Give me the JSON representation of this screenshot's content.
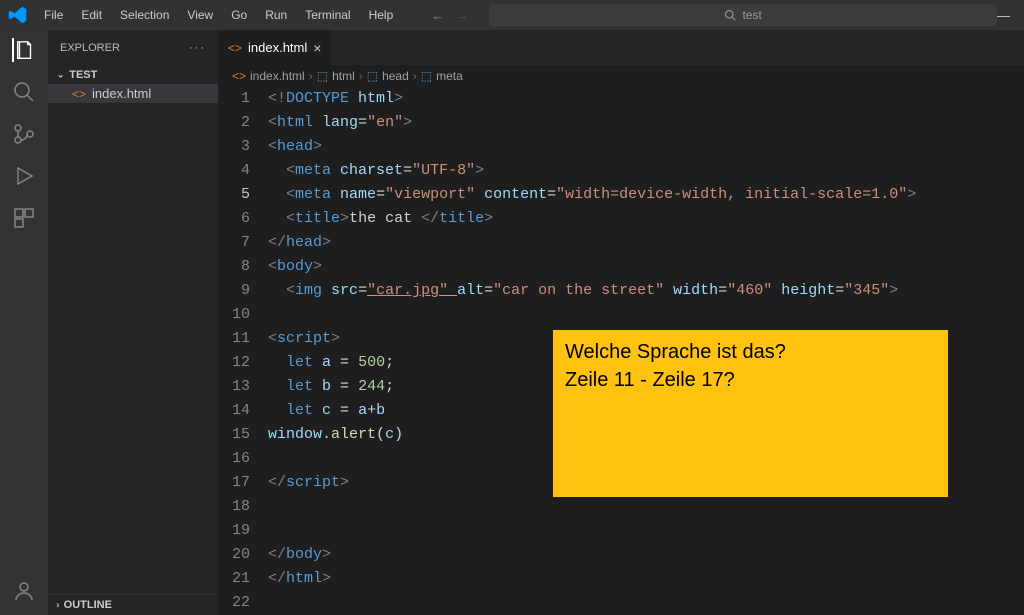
{
  "menu": [
    "File",
    "Edit",
    "Selection",
    "View",
    "Go",
    "Run",
    "Terminal",
    "Help"
  ],
  "search": {
    "placeholder": "test"
  },
  "sidebar": {
    "title": "EXPLORER",
    "folder": "TEST",
    "file": "index.html",
    "outline": "OUTLINE"
  },
  "tab": {
    "name": "index.html"
  },
  "breadcrumb": [
    "index.html",
    "html",
    "head",
    "meta"
  ],
  "annotation": {
    "line1": "Welche Sprache ist das?",
    "line2": "Zeile 11 - Zeile 17?"
  },
  "code": {
    "current_line": 5,
    "lines": [
      {
        "n": 1,
        "tokens": [
          {
            "c": "t-gray",
            "t": "<!"
          },
          {
            "c": "t-blue",
            "t": "DOCTYPE "
          },
          {
            "c": "t-attr",
            "t": "html"
          },
          {
            "c": "t-gray",
            "t": ">"
          }
        ]
      },
      {
        "n": 2,
        "tokens": [
          {
            "c": "t-gray",
            "t": "<"
          },
          {
            "c": "t-blue",
            "t": "html "
          },
          {
            "c": "t-attr",
            "t": "lang"
          },
          {
            "c": "t-txt",
            "t": "="
          },
          {
            "c": "t-str",
            "t": "\"en\""
          },
          {
            "c": "t-gray",
            "t": ">"
          }
        ]
      },
      {
        "n": 3,
        "tokens": [
          {
            "c": "t-gray",
            "t": "<"
          },
          {
            "c": "t-blue",
            "t": "head"
          },
          {
            "c": "t-gray",
            "t": ">"
          }
        ]
      },
      {
        "n": 4,
        "tokens": [
          {
            "c": "",
            "t": "  "
          },
          {
            "c": "t-gray",
            "t": "<"
          },
          {
            "c": "t-blue",
            "t": "meta "
          },
          {
            "c": "t-attr",
            "t": "charset"
          },
          {
            "c": "t-txt",
            "t": "="
          },
          {
            "c": "t-str",
            "t": "\"UTF-8\""
          },
          {
            "c": "t-gray",
            "t": ">"
          }
        ]
      },
      {
        "n": 5,
        "tokens": [
          {
            "c": "",
            "t": "  "
          },
          {
            "c": "t-gray",
            "t": "<"
          },
          {
            "c": "t-blue",
            "t": "meta "
          },
          {
            "c": "t-attr",
            "t": "name"
          },
          {
            "c": "t-txt",
            "t": "="
          },
          {
            "c": "t-str",
            "t": "\"viewport\" "
          },
          {
            "c": "t-attr",
            "t": "content"
          },
          {
            "c": "t-txt",
            "t": "="
          },
          {
            "c": "t-str",
            "t": "\"width=device-width, initial-scale=1.0\""
          },
          {
            "c": "t-gray",
            "t": ">"
          }
        ]
      },
      {
        "n": 6,
        "tokens": [
          {
            "c": "",
            "t": "  "
          },
          {
            "c": "t-gray",
            "t": "<"
          },
          {
            "c": "t-blue",
            "t": "title"
          },
          {
            "c": "t-gray",
            "t": ">"
          },
          {
            "c": "t-txt",
            "t": "the cat "
          },
          {
            "c": "t-gray",
            "t": "</"
          },
          {
            "c": "t-blue",
            "t": "title"
          },
          {
            "c": "t-gray",
            "t": ">"
          }
        ]
      },
      {
        "n": 7,
        "tokens": [
          {
            "c": "t-gray",
            "t": "</"
          },
          {
            "c": "t-blue",
            "t": "head"
          },
          {
            "c": "t-gray",
            "t": ">"
          }
        ]
      },
      {
        "n": 8,
        "tokens": [
          {
            "c": "t-gray",
            "t": "<"
          },
          {
            "c": "t-blue",
            "t": "body"
          },
          {
            "c": "t-gray",
            "t": ">"
          }
        ]
      },
      {
        "n": 9,
        "tokens": [
          {
            "c": "",
            "t": "  "
          },
          {
            "c": "t-gray",
            "t": "<"
          },
          {
            "c": "t-blue",
            "t": "img "
          },
          {
            "c": "t-attr",
            "t": "src"
          },
          {
            "c": "t-txt",
            "t": "="
          },
          {
            "c": "t-str t-ul",
            "t": "\"car.jpg\" "
          },
          {
            "c": "t-attr",
            "t": "alt"
          },
          {
            "c": "t-txt",
            "t": "="
          },
          {
            "c": "t-str",
            "t": "\"car on the street\" "
          },
          {
            "c": "t-attr",
            "t": "width"
          },
          {
            "c": "t-txt",
            "t": "="
          },
          {
            "c": "t-str",
            "t": "\"460\" "
          },
          {
            "c": "t-attr",
            "t": "height"
          },
          {
            "c": "t-txt",
            "t": "="
          },
          {
            "c": "t-str",
            "t": "\"345\""
          },
          {
            "c": "t-gray",
            "t": ">"
          }
        ]
      },
      {
        "n": 10,
        "tokens": []
      },
      {
        "n": 11,
        "tokens": [
          {
            "c": "t-gray",
            "t": "<"
          },
          {
            "c": "t-blue",
            "t": "script"
          },
          {
            "c": "t-gray",
            "t": ">"
          }
        ]
      },
      {
        "n": 12,
        "tokens": [
          {
            "c": "",
            "t": "  "
          },
          {
            "c": "t-kw",
            "t": "let "
          },
          {
            "c": "t-var",
            "t": "a "
          },
          {
            "c": "t-txt",
            "t": "= "
          },
          {
            "c": "t-num",
            "t": "500"
          },
          {
            "c": "t-txt",
            "t": ";"
          }
        ]
      },
      {
        "n": 13,
        "tokens": [
          {
            "c": "",
            "t": "  "
          },
          {
            "c": "t-kw",
            "t": "let "
          },
          {
            "c": "t-var",
            "t": "b "
          },
          {
            "c": "t-txt",
            "t": "= "
          },
          {
            "c": "t-num",
            "t": "244"
          },
          {
            "c": "t-txt",
            "t": ";"
          }
        ]
      },
      {
        "n": 14,
        "tokens": [
          {
            "c": "",
            "t": "  "
          },
          {
            "c": "t-kw",
            "t": "let "
          },
          {
            "c": "t-var",
            "t": "c "
          },
          {
            "c": "t-txt",
            "t": "= "
          },
          {
            "c": "t-var",
            "t": "a"
          },
          {
            "c": "t-txt",
            "t": "+"
          },
          {
            "c": "t-var",
            "t": "b"
          }
        ]
      },
      {
        "n": 15,
        "tokens": [
          {
            "c": "t-var",
            "t": "window"
          },
          {
            "c": "t-txt",
            "t": "."
          },
          {
            "c": "t-fn",
            "t": "alert"
          },
          {
            "c": "t-txt",
            "t": "("
          },
          {
            "c": "t-var",
            "t": "c"
          },
          {
            "c": "t-txt",
            "t": ")"
          }
        ]
      },
      {
        "n": 16,
        "tokens": []
      },
      {
        "n": 17,
        "tokens": [
          {
            "c": "t-gray",
            "t": "</"
          },
          {
            "c": "t-blue",
            "t": "script"
          },
          {
            "c": "t-gray",
            "t": ">"
          }
        ]
      },
      {
        "n": 18,
        "tokens": []
      },
      {
        "n": 19,
        "tokens": []
      },
      {
        "n": 20,
        "tokens": [
          {
            "c": "t-gray",
            "t": "</"
          },
          {
            "c": "t-blue",
            "t": "body"
          },
          {
            "c": "t-gray",
            "t": ">"
          }
        ]
      },
      {
        "n": 21,
        "tokens": [
          {
            "c": "t-gray",
            "t": "</"
          },
          {
            "c": "t-blue",
            "t": "html"
          },
          {
            "c": "t-gray",
            "t": ">"
          }
        ]
      },
      {
        "n": 22,
        "tokens": []
      }
    ]
  }
}
